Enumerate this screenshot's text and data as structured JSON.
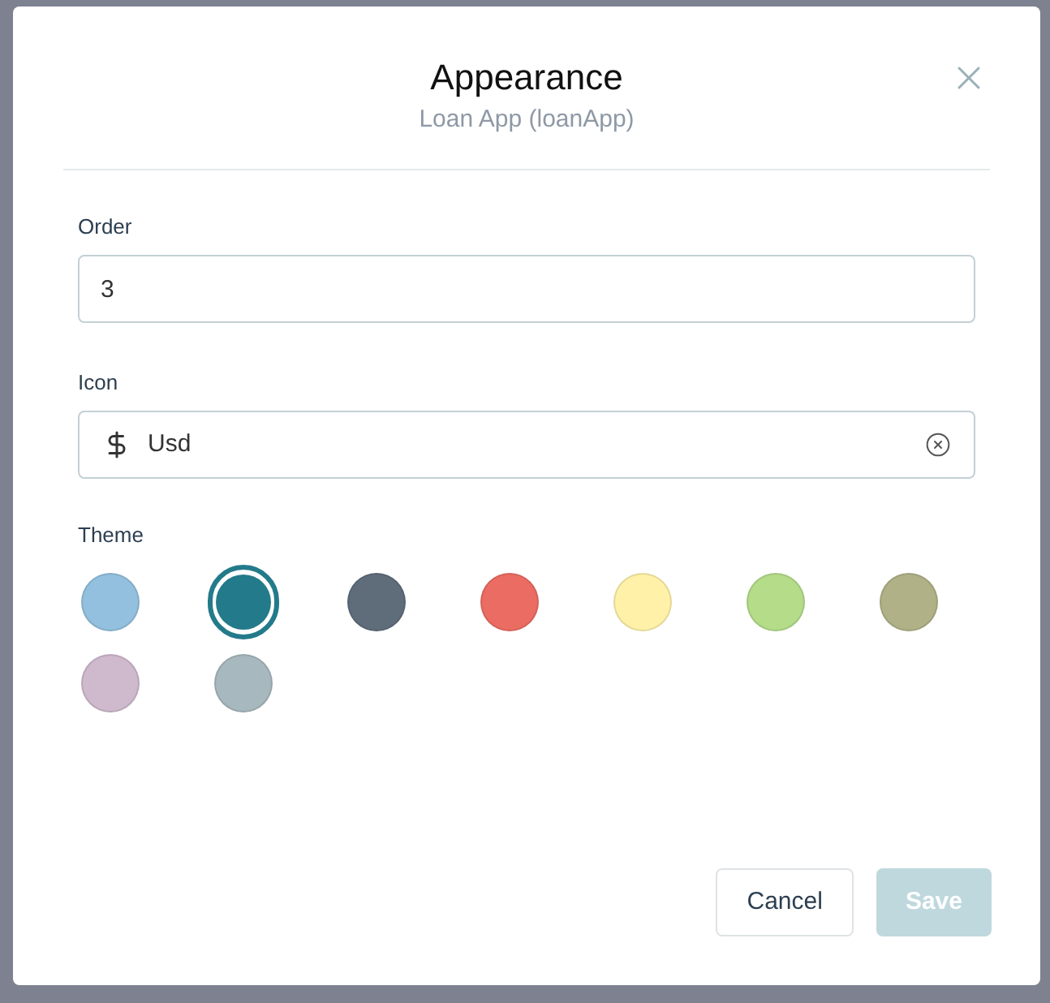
{
  "dialog": {
    "title": "Appearance",
    "subtitle": "Loan App (loanApp)"
  },
  "order": {
    "label": "Order",
    "value": "3"
  },
  "icon": {
    "label": "Icon",
    "value": "Usd"
  },
  "theme": {
    "label": "Theme",
    "swatches": [
      {
        "color": "#93c0de",
        "selected": false
      },
      {
        "color": "#237a8a",
        "selected": true
      },
      {
        "color": "#5f6d7b",
        "selected": false
      },
      {
        "color": "#eb6c62",
        "selected": false
      },
      {
        "color": "#fff1a8",
        "selected": false
      },
      {
        "color": "#b4dc89",
        "selected": false
      },
      {
        "color": "#b0b186",
        "selected": false
      },
      {
        "color": "#cfb9cd",
        "selected": false
      },
      {
        "color": "#a7b8be",
        "selected": false
      }
    ]
  },
  "buttons": [
    {
      "kind": "secondary",
      "label": "Cancel",
      "disabled": false
    },
    {
      "kind": "primary",
      "label": "Save",
      "disabled": true
    }
  ]
}
